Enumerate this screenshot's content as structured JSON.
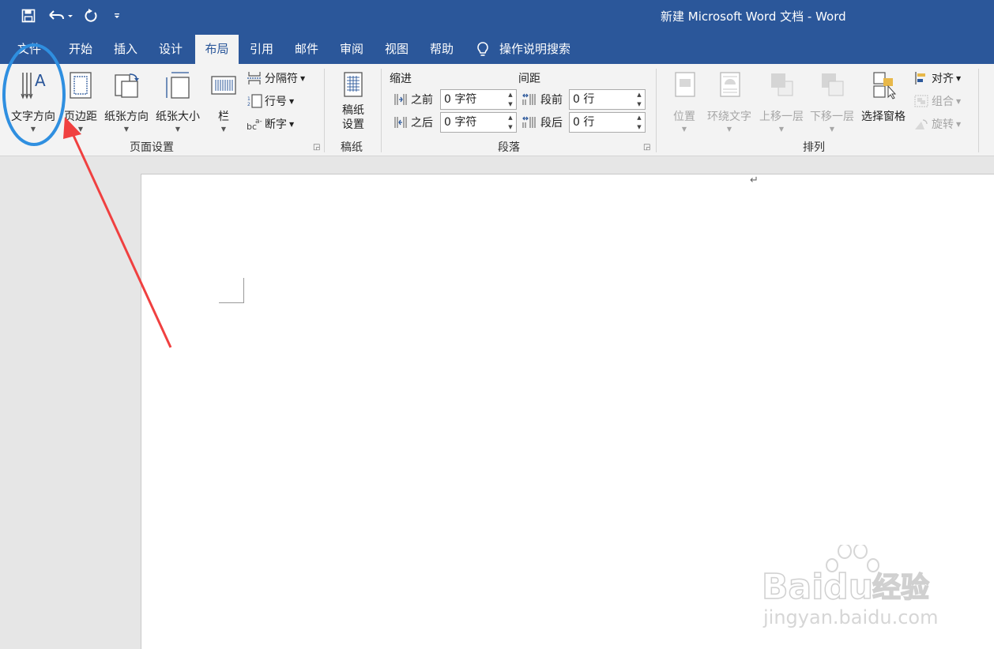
{
  "window": {
    "title": "新建 Microsoft Word 文档  -  Word"
  },
  "qat": {
    "save_icon": "save-icon",
    "undo_icon": "undo-icon",
    "redo_icon": "redo-icon",
    "customize_icon": "customize-qat-icon"
  },
  "tabs": [
    {
      "label": "文件"
    },
    {
      "label": "开始"
    },
    {
      "label": "插入"
    },
    {
      "label": "设计"
    },
    {
      "label": "布局"
    },
    {
      "label": "引用"
    },
    {
      "label": "邮件"
    },
    {
      "label": "审阅"
    },
    {
      "label": "视图"
    },
    {
      "label": "帮助"
    }
  ],
  "active_tab": "布局",
  "tell_me": {
    "label": "操作说明搜索"
  },
  "page_setup": {
    "text_direction": "文字方向",
    "margins": "页边距",
    "orientation": "纸张方向",
    "size": "纸张大小",
    "columns": "栏",
    "breaks": "分隔符",
    "line_numbers": "行号",
    "hyphenation": "断字",
    "group_label": "页面设置"
  },
  "manuscript": {
    "button_line1": "稿纸",
    "button_line2": "设置",
    "group_label": "稿纸"
  },
  "paragraph": {
    "indent_header": "缩进",
    "spacing_header": "间距",
    "indent_before_label": "之前",
    "indent_before_value": "0 字符",
    "indent_after_label": "之后",
    "indent_after_value": "0 字符",
    "spacing_before_label": "段前",
    "spacing_before_value": "0 行",
    "spacing_after_label": "段后",
    "spacing_after_value": "0 行",
    "group_label": "段落"
  },
  "arrange": {
    "position": "位置",
    "wrap_text": "环绕文字",
    "bring_forward": "上移一层",
    "send_backward": "下移一层",
    "selection_pane": "选择窗格",
    "align": "对齐",
    "group": "组合",
    "rotate": "旋转",
    "group_label": "排列"
  },
  "document": {
    "paragraph_mark": "↵"
  },
  "watermark": {
    "brand": "Baidu",
    "brand_cn": "经验",
    "url": "jingyan.baidu.com"
  },
  "colors": {
    "title_bar": "#2b579a",
    "ribbon": "#f3f3f3",
    "annotation_circle": "#2f8fe0",
    "annotation_arrow": "#f04040"
  }
}
